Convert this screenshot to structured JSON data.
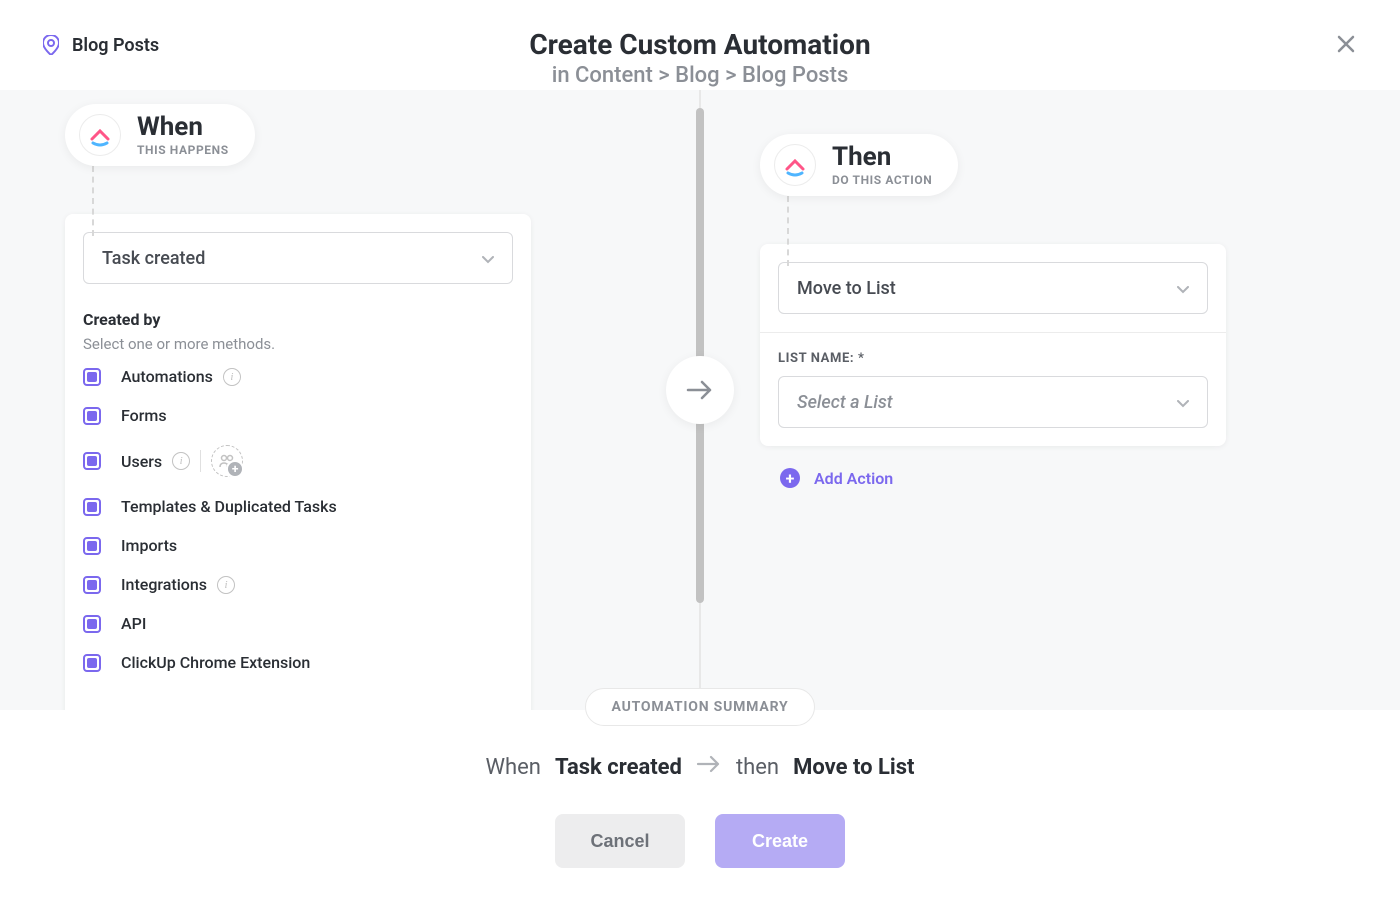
{
  "context": {
    "name": "Blog Posts"
  },
  "header": {
    "title": "Create Custom Automation",
    "breadcrumb": "in Content > Blog > Blog Posts"
  },
  "when": {
    "title": "When",
    "subtitle": "THIS HAPPENS",
    "trigger": {
      "selected": "Task created"
    },
    "created_by": {
      "label": "Created by",
      "hint": "Select one or more methods.",
      "methods": [
        {
          "label": "Automations",
          "info": true,
          "assignee": false
        },
        {
          "label": "Forms",
          "info": false,
          "assignee": false
        },
        {
          "label": "Users",
          "info": true,
          "assignee": true
        },
        {
          "label": "Templates & Duplicated Tasks",
          "info": false,
          "assignee": false
        },
        {
          "label": "Imports",
          "info": false,
          "assignee": false
        },
        {
          "label": "Integrations",
          "info": true,
          "assignee": false
        },
        {
          "label": "API",
          "info": false,
          "assignee": false
        },
        {
          "label": "ClickUp Chrome Extension",
          "info": false,
          "assignee": false
        }
      ]
    }
  },
  "then": {
    "title": "Then",
    "subtitle": "DO THIS ACTION",
    "action": {
      "selected": "Move to List",
      "list_name_label": "LIST NAME: *",
      "list_placeholder": "Select a List"
    },
    "add_action": "Add Action"
  },
  "summary": {
    "pill": "AUTOMATION SUMMARY",
    "when_prefix": "When",
    "when_value": "Task created",
    "then_prefix": "then",
    "then_value": "Move to List"
  },
  "buttons": {
    "cancel": "Cancel",
    "create": "Create"
  }
}
